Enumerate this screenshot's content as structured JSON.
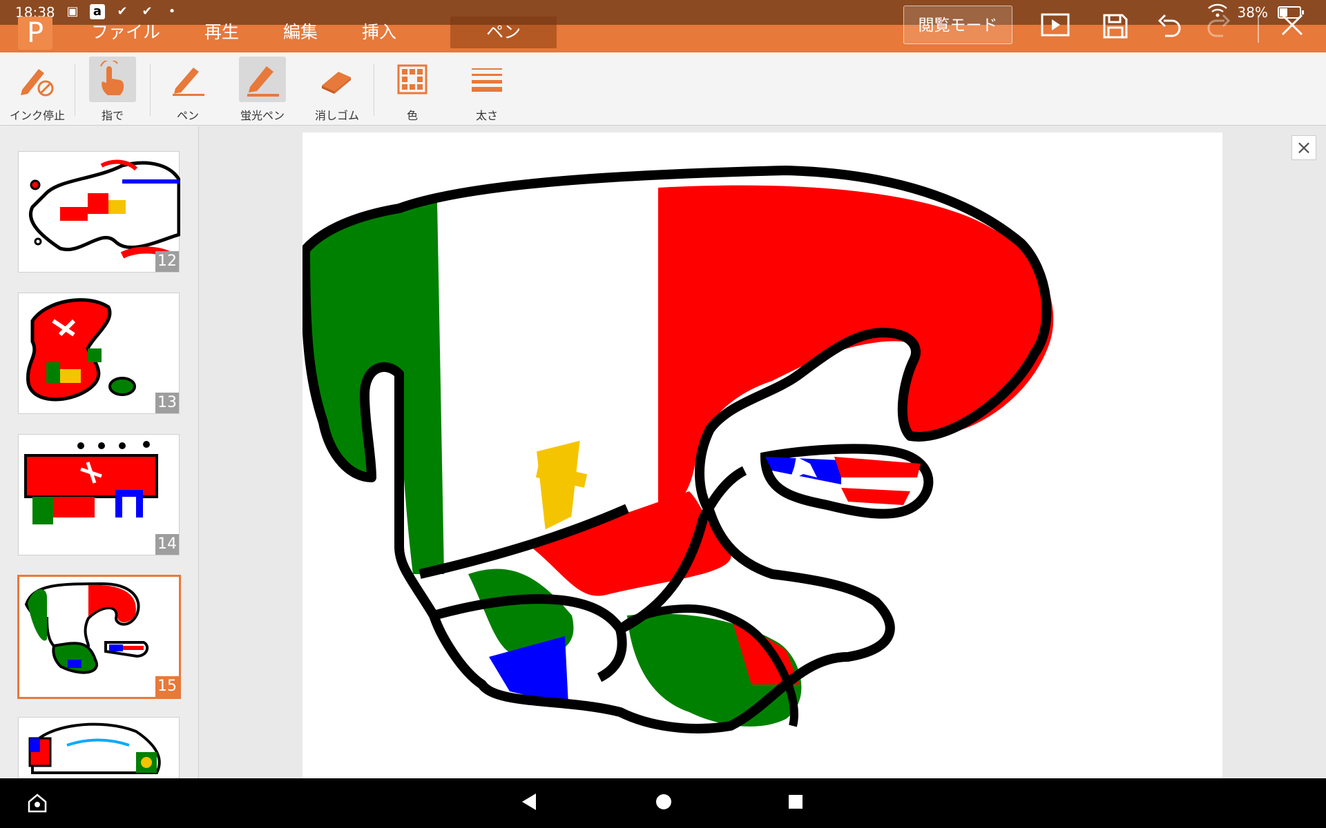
{
  "status": {
    "time": "18:38",
    "battery": "38%",
    "battery_level": 0.38,
    "amazon_glyph": "a"
  },
  "app": {
    "logo_letter": "P"
  },
  "menu": {
    "tabs": [
      {
        "label": "ファイル"
      },
      {
        "label": "再生"
      },
      {
        "label": "編集"
      },
      {
        "label": "挿入"
      },
      {
        "label": "ペン"
      }
    ],
    "active_tab": "ペン",
    "reading_mode": "閲覧モード",
    "icons": [
      "play-slideshow-icon",
      "save-icon",
      "undo-icon",
      "redo-icon",
      "close-icon"
    ]
  },
  "toolbar": {
    "tools": [
      {
        "label": "インク停止",
        "icon": "ink-stop-icon",
        "selected": false
      },
      {
        "label": "指で",
        "icon": "finger-icon",
        "selected": true
      },
      {
        "label": "ペン",
        "icon": "pen-icon",
        "selected": false
      },
      {
        "label": "蛍光ペン",
        "icon": "highlighter-icon",
        "selected": true
      },
      {
        "label": "消しゴム",
        "icon": "eraser-icon",
        "selected": false
      },
      {
        "label": "色",
        "icon": "color-grid-icon",
        "selected": false
      },
      {
        "label": "太さ",
        "icon": "thickness-icon",
        "selected": false
      }
    ]
  },
  "slides": {
    "thumbnails": [
      {
        "number": "12"
      },
      {
        "number": "13"
      },
      {
        "number": "14"
      },
      {
        "number": "15",
        "active": true
      },
      {
        "number": ""
      }
    ]
  },
  "colors": {
    "accent": "#e7793a",
    "status_bar": "#8c4a22",
    "green": "#008000",
    "red": "#ff0000",
    "blue": "#0000ff",
    "yellow": "#f5c400"
  }
}
